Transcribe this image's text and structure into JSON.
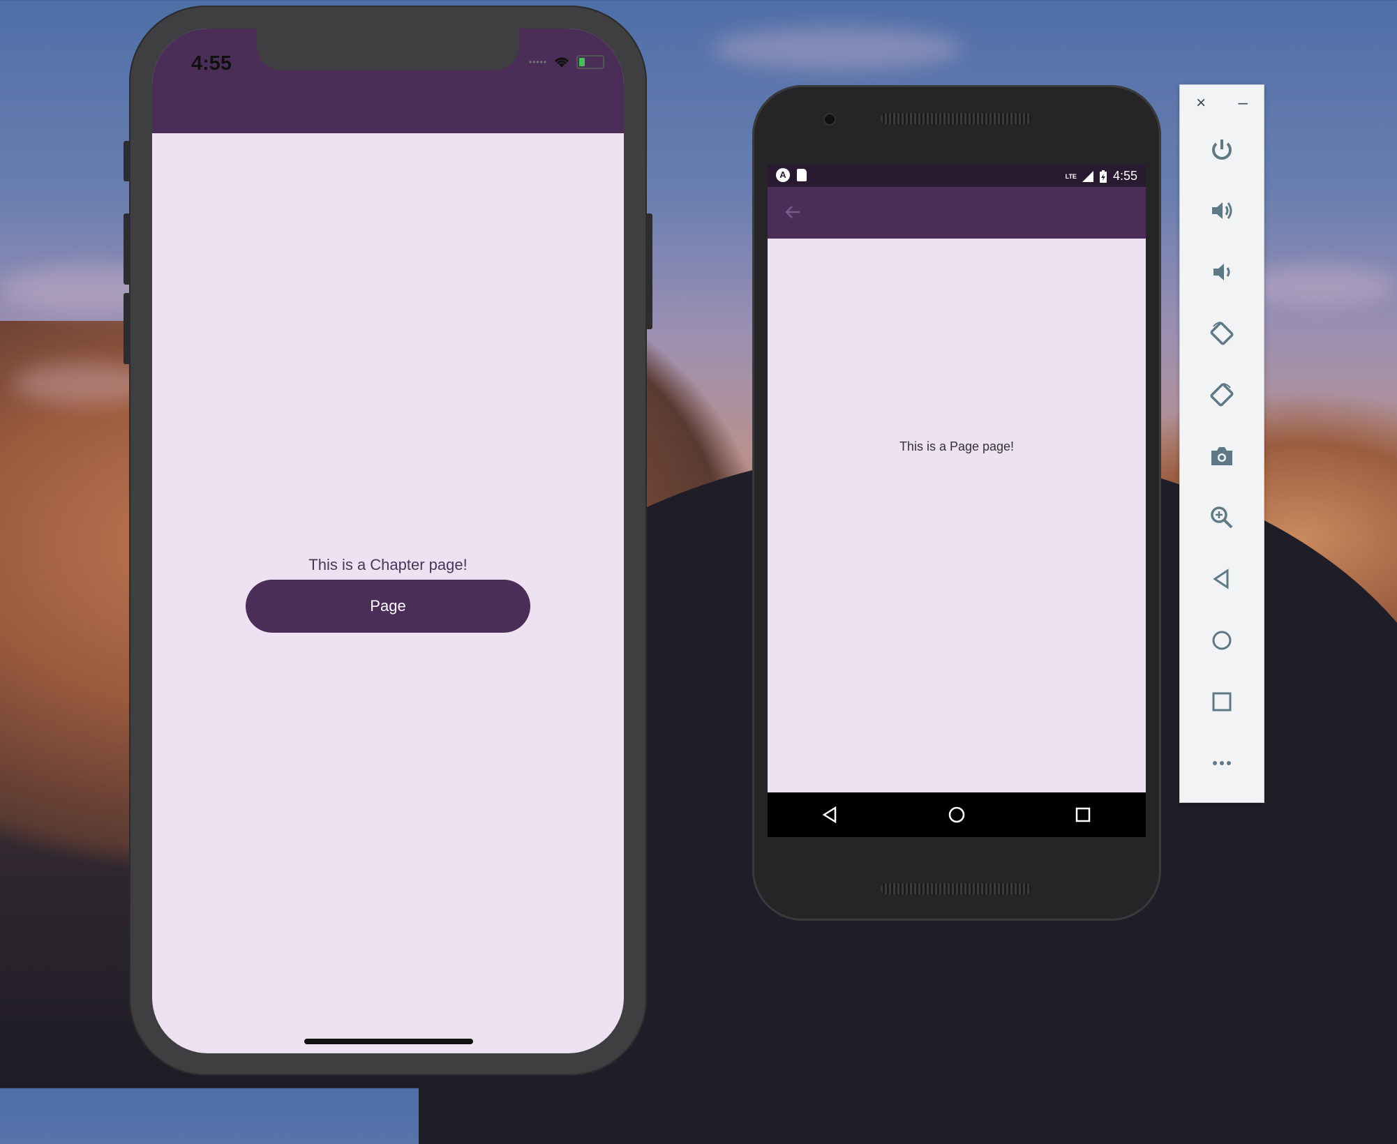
{
  "ios": {
    "time": "4:55",
    "status_dots": "•••••",
    "content_text": "This is a Chapter page!",
    "button_label": "Page"
  },
  "android": {
    "time": "4:55",
    "status_a": "A",
    "network": "LTE",
    "content_text": "This is a Page page!"
  },
  "emulator_toolbar": {
    "close": "×",
    "minimize": "–",
    "items": [
      "power-icon",
      "volume-up-icon",
      "volume-down-icon",
      "rotate-left-icon",
      "rotate-right-icon",
      "camera-icon",
      "zoom-icon",
      "back-icon",
      "home-icon",
      "overview-icon",
      "more-icon"
    ]
  },
  "colors": {
    "header": "#4a2e57",
    "page_background": "#ede1f2",
    "toolbar_icon": "#5f7886"
  }
}
